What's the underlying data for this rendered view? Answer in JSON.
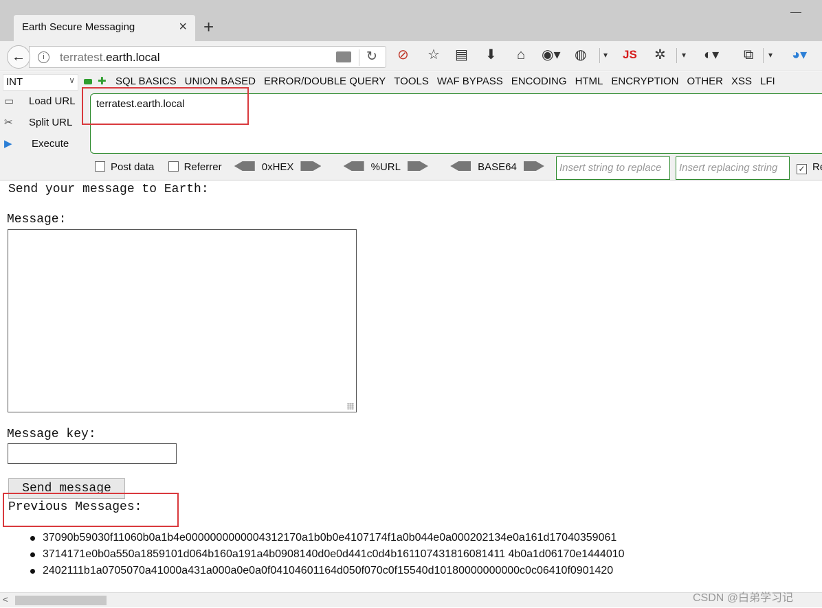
{
  "browser": {
    "tab_title": "Earth Secure Messaging",
    "tab_close": "×",
    "new_tab": "+",
    "url_prefix": "terratest.",
    "url_domain": "earth.local",
    "icons": [
      "back-arrow-icon",
      "info-icon",
      "storage-icon",
      "reload-icon",
      "blocked-icon",
      "star-icon",
      "reader-icon",
      "download-icon",
      "home-icon",
      "globe-icon",
      "cookie-icon",
      "js-icon",
      "bug-icon",
      "proxy-icon",
      "devices-icon",
      "chrome-icon"
    ],
    "js_label": "JS"
  },
  "hackbar": {
    "select_value": "INT",
    "menu": [
      "SQL BASICS",
      "UNION BASED",
      "ERROR/DOUBLE QUERY",
      "TOOLS",
      "WAF BYPASS",
      "ENCODING",
      "HTML",
      "ENCRYPTION",
      "OTHER",
      "XSS",
      "LFI"
    ],
    "load_url": "Load URL",
    "split_url": "Split URL",
    "execute": "Execute",
    "url_value": "terratest.earth.local",
    "post_data": "Post data",
    "referrer": "Referrer",
    "hex": "0xHEX",
    "url_enc": "%URL",
    "base64": "BASE64",
    "replace_placeholder": "Insert string to replace",
    "replacing_placeholder": "Insert replacing string",
    "re_label": "Re",
    "highlight_color": "#d9393d",
    "accent_green": "#2e8b2e"
  },
  "page": {
    "heading": "Send your message to Earth:",
    "message_label": "Message:",
    "key_label": "Message key:",
    "send_button": "Send message",
    "previous_label": "Previous Messages:",
    "messages": [
      "37090b59030f11060b0a1b4e0000000000004312170a1b0b0e4107174f1a0b044e0a000202134e0a161d17040359061",
      "3714171e0b0a550a1859101d064b160a191a4b0908140d0e0d441c0d4b161107431816081411 4b0a1d06170e1444010",
      "2402111b1a0705070a41000a431a000a0e0a0f04104601164d050f070c0f15540d10180000000000c0c06410f0901420"
    ]
  },
  "watermark": "CSDN @白弟学习记"
}
